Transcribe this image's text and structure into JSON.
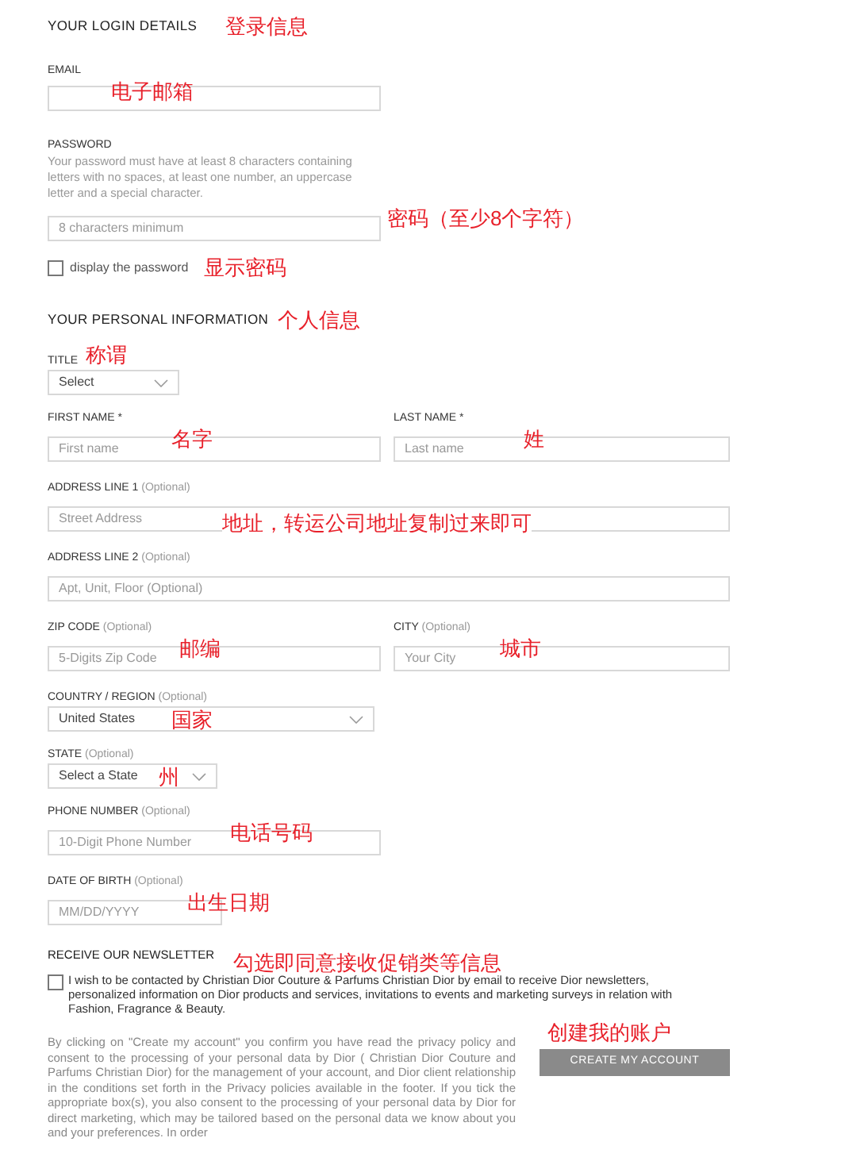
{
  "login": {
    "heading": "YOUR LOGIN DETAILS",
    "note": "登录信息",
    "email": {
      "label": "EMAIL",
      "note": "电子邮箱"
    },
    "password": {
      "label": "PASSWORD",
      "help": "Your password must have at least 8 characters containing letters with no spaces, at least one number, an uppercase letter and a special character.",
      "placeholder": "8 characters minimum",
      "note": "密码（至少8个字符）"
    },
    "show_password": {
      "label": "display the password",
      "checked": false,
      "note": "显示密码"
    }
  },
  "personal": {
    "heading": "YOUR PERSONAL INFORMATION",
    "note": "个人信息",
    "title": {
      "label": "TITLE",
      "kind": "select",
      "value": "Select",
      "note": "称谓"
    },
    "first_name": {
      "label": "FIRST NAME *",
      "kind": "input",
      "placeholder": "First name",
      "note": "名字"
    },
    "last_name": {
      "label": "LAST NAME *",
      "kind": "input",
      "placeholder": "Last name",
      "note": "姓"
    },
    "address_1": {
      "label": "ADDRESS LINE 1",
      "hint": "(Optional)",
      "kind": "input",
      "placeholder": "Street Address",
      "note": "地址，转运公司地址复制过来即可"
    },
    "address_2": {
      "label": "ADDRESS LINE 2",
      "hint": "(Optional)",
      "kind": "input",
      "placeholder": "Apt, Unit, Floor (Optional)"
    },
    "zip": {
      "label": "ZIP CODE",
      "hint": "(Optional)",
      "kind": "input",
      "placeholder": "5-Digits Zip Code",
      "note": "邮编"
    },
    "city": {
      "label": "CITY",
      "hint": "(Optional)",
      "kind": "input",
      "placeholder": "Your City",
      "note": "城市"
    },
    "country": {
      "label": "COUNTRY / REGION",
      "hint": "(Optional)",
      "kind": "select",
      "value": "United States",
      "note": "国家"
    },
    "state": {
      "label": "STATE",
      "hint": "(Optional)",
      "kind": "select",
      "value": "Select a State",
      "note": "州"
    },
    "phone": {
      "label": "PHONE NUMBER",
      "hint": "(Optional)",
      "kind": "input",
      "placeholder": "10-Digit Phone Number",
      "note": "电话号码"
    },
    "birth": {
      "label": "DATE OF BIRTH",
      "hint": "(Optional)",
      "kind": "input",
      "placeholder": "MM/DD/YYYY",
      "note": "出生日期"
    }
  },
  "newsletter": {
    "heading": "RECEIVE OUR NEWSLETTER",
    "note": "勾选即同意接收促销类等信息",
    "consent": {
      "label": "I wish to be contacted by Christian Dior Couture & Parfums Christian Dior by email to receive Dior newsletters, personalized information on Dior products and services, invitations to events and marketing surveys in relation with Fashion, Fragrance & Beauty.",
      "checked": false
    }
  },
  "legal": "By clicking on \"Create my account\" you confirm you have read the privacy policy and consent to the processing of your personal data by Dior ( Christian Dior Couture and Parfums Christian Dior) for the management of your account, and Dior client relationship in the conditions set forth in the Privacy policies available in the footer. If you tick the appropriate box(s), you also consent to the processing of your personal data by Dior for direct marketing, which may be tailored based on the personal data we know about you and your preferences. In order",
  "create": {
    "note": "创建我的账户",
    "button": "CREATE MY ACCOUNT"
  }
}
